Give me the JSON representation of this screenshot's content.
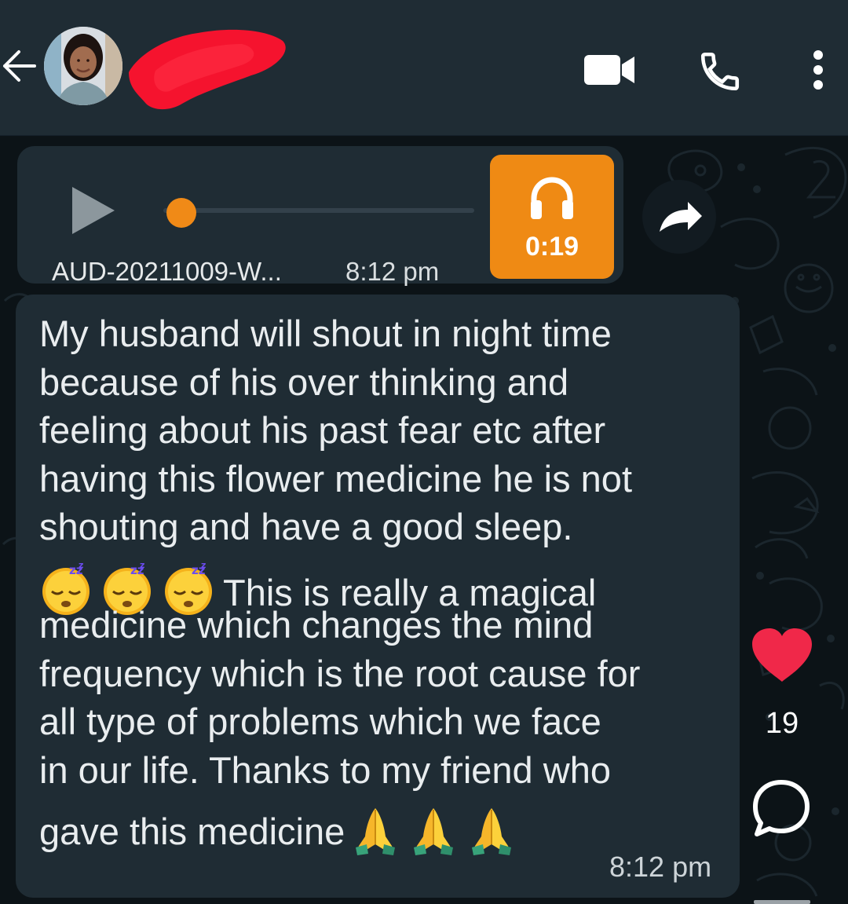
{
  "header": {
    "back_icon": "arrow-left-icon",
    "avatar_icon": "profile-photo",
    "contact_name_redacted": true,
    "video_call_icon": "video-camera-icon",
    "voice_call_icon": "phone-icon",
    "menu_icon": "more-vertical-icon"
  },
  "audio_message": {
    "play_icon": "play-icon",
    "progress": 0,
    "file_name": "AUD-20211009-W...",
    "time": "8:12 pm",
    "badge_icon": "headphones-icon",
    "duration": "0:19",
    "forward_icon": "forward-arrow-icon"
  },
  "text_message": {
    "lines": [
      "My husband will shout in night time",
      "because of his over thinking and",
      "feeling about his past fear etc after",
      "having this flower medicine he is not",
      "shouting and have a good  sleep.",
      "This is really a magical",
      "medicine which changes the mind",
      "frequency which is the root cause for",
      "all type of problems which we face",
      "in our life. Thanks to my friend who",
      "gave this medicine"
    ],
    "sleeping_emojis": [
      "😴",
      "😴",
      "😴"
    ],
    "prayer_emojis": [
      "🙏",
      "🙏",
      "🙏"
    ],
    "time": "8:12 pm"
  },
  "reactions": {
    "like_icon": "heart-icon",
    "like_count": "19",
    "comment_icon": "comment-bubble-icon"
  },
  "colors": {
    "header_bg": "#1f2c34",
    "chat_bg": "#0c1317",
    "bubble_bg": "#1f2c34",
    "accent_orange": "#ef8a14",
    "heart_red": "#f02849",
    "redaction_red": "#f5132e"
  }
}
